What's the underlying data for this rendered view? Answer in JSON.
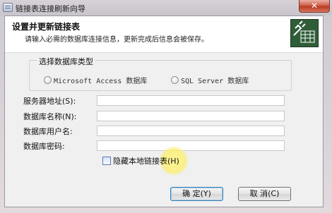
{
  "window": {
    "title": "链接表连接刷新向导",
    "close_symbol": "✕"
  },
  "header": {
    "title": "设置并更新链接表",
    "description": "请输入必需的数据库连接信息，更新完成后信息会被保存。",
    "icon": "linked-table-plug-icon"
  },
  "db_type": {
    "legend": "选择数据库类型",
    "options": [
      {
        "label": "Microsoft Access 数据库",
        "selected": false
      },
      {
        "label": "SQL Server 数据库",
        "selected": false
      }
    ]
  },
  "fields": [
    {
      "label": "服务器地址(S):",
      "value": ""
    },
    {
      "label": "数据库名称(N):",
      "value": ""
    },
    {
      "label": "数据库用户名:",
      "value": ""
    },
    {
      "label": "数据库密码:",
      "value": ""
    }
  ],
  "hide_local": {
    "label": "隐藏本地链接表(H)",
    "checked": false
  },
  "buttons": {
    "ok": "确 定(Y)",
    "cancel": "取 消(C)"
  }
}
